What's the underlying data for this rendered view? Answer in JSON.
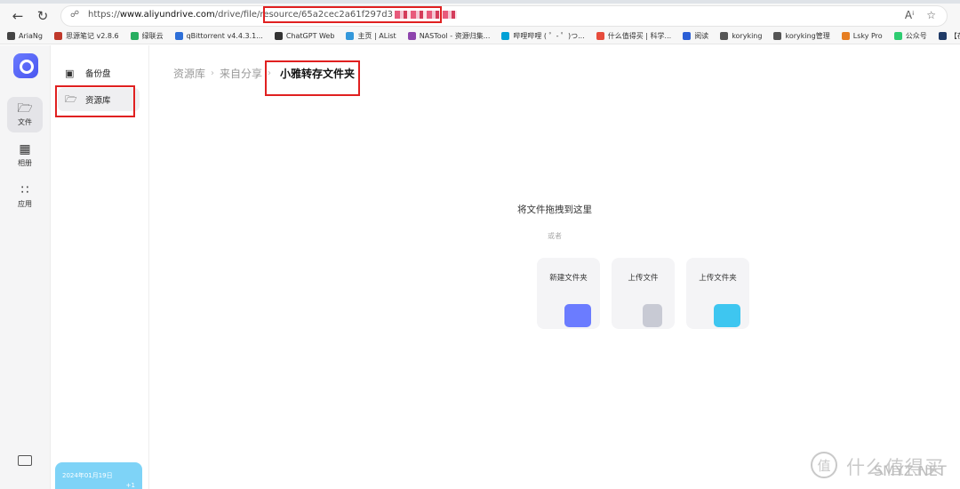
{
  "browser": {
    "url_prefix": "https://",
    "url_host": "www.aliyundrive.com",
    "url_path": "/drive/file/resource/",
    "url_id": "65a2cec2a61f297d3",
    "back_icon": "arrow-left-icon",
    "refresh_icon": "refresh-icon",
    "read_aloud_label": "Aⁱ",
    "favorite_icon": "star-icon"
  },
  "bookmarks": [
    {
      "label": "AriaNg",
      "color": "#444444"
    },
    {
      "label": "思源笔记 v2.8.6",
      "color": "#c0392b"
    },
    {
      "label": "绿联云",
      "color": "#27ae60"
    },
    {
      "label": "qBittorrent v4.4.3.1...",
      "color": "#2e6fd8"
    },
    {
      "label": "ChatGPT Web",
      "color": "#333333"
    },
    {
      "label": "主页 | AList",
      "color": "#3498db"
    },
    {
      "label": "NASTool - 资源归集...",
      "color": "#8e44ad"
    },
    {
      "label": "哔哩哔哩 ( ゜- ゜)つ...",
      "color": "#00a1d6"
    },
    {
      "label": "什么值得买 | 科学...",
      "color": "#e74c3c"
    },
    {
      "label": "阅读",
      "color": "#2c5fd6"
    },
    {
      "label": "koryking",
      "color": "#555555"
    },
    {
      "label": "koryking管理",
      "color": "#555555"
    },
    {
      "label": "Lsky Pro",
      "color": "#e67e22"
    },
    {
      "label": "公众号",
      "color": "#2ecc71"
    },
    {
      "label": "【在线PS软件",
      "color": "#1f3a66"
    }
  ],
  "rail": {
    "items": [
      {
        "label": "文件",
        "icon": "folder-icon"
      },
      {
        "label": "相册",
        "icon": "image-icon"
      },
      {
        "label": "应用",
        "icon": "apps-icon"
      }
    ]
  },
  "sidebar": {
    "items": [
      {
        "label": "备份盘",
        "icon": "backup-drive-icon"
      },
      {
        "label": "资源库",
        "icon": "resource-folder-icon"
      }
    ],
    "date_card": {
      "date": "2024年01月19日",
      "plus": "+1"
    }
  },
  "breadcrumb": {
    "items": [
      "资源库",
      "来自分享"
    ],
    "current": "小雅转存文件夹"
  },
  "dropzone": {
    "title": "将文件拖拽到这里",
    "or": "或者",
    "cards": [
      {
        "label": "新建文件夹",
        "icon": "new-folder-icon",
        "color": "#6b7cff"
      },
      {
        "label": "上传文件",
        "icon": "upload-file-icon",
        "color": "#c8cad4"
      },
      {
        "label": "上传文件夹",
        "icon": "upload-folder-icon",
        "color": "#3ec6f0"
      }
    ]
  },
  "watermark": {
    "circle": "值",
    "text": "什么值得买",
    "site": "SMYZ.NET"
  }
}
